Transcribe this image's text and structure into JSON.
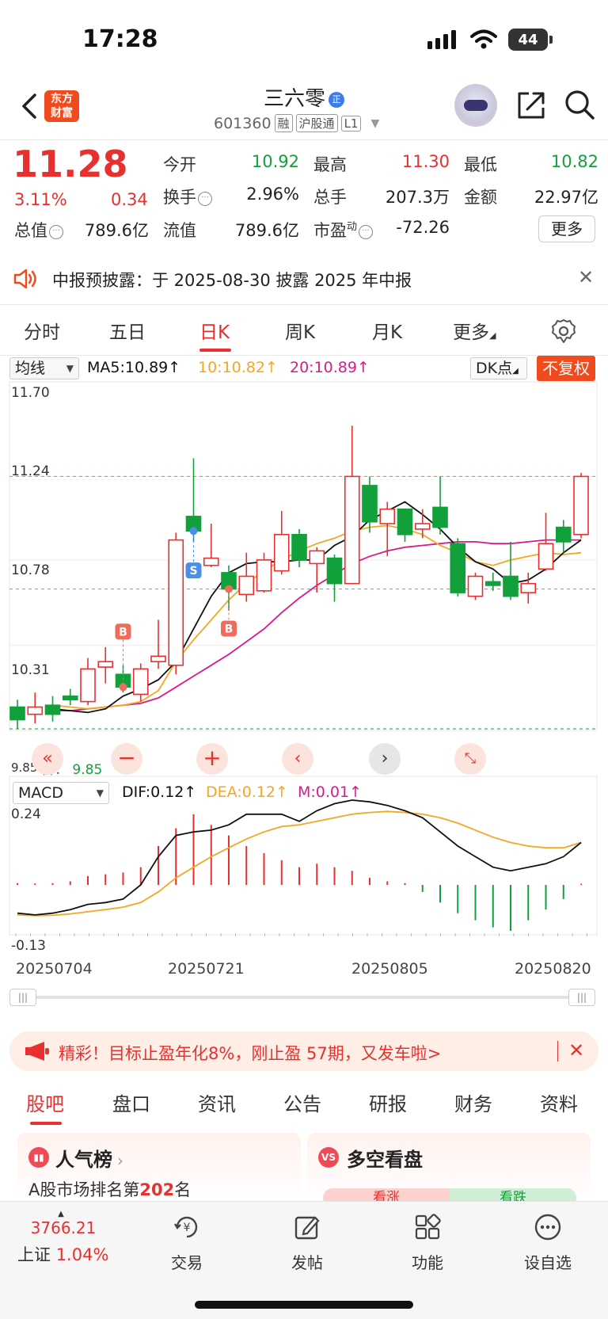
{
  "status": {
    "time": "17:28",
    "battery": "44"
  },
  "header": {
    "logo_line1": "东方",
    "logo_line2": "财富",
    "stock_name": "三六零",
    "stock_badge": "正",
    "stock_code": "601360",
    "tags": [
      "融",
      "沪股通",
      "L1"
    ]
  },
  "quote": {
    "price": "11.28",
    "change_pct": "3.11%",
    "change": "0.34",
    "fields": {
      "open_label": "今开",
      "open": "10.92",
      "high_label": "最高",
      "high": "11.30",
      "low_label": "最低",
      "low": "10.82",
      "turnover_label": "换手",
      "turnover": "2.96%",
      "volume_label": "总手",
      "volume": "207.3万",
      "amount_label": "金额",
      "amount": "22.97亿",
      "mktcap_label": "总值",
      "mktcap": "789.6亿",
      "float_label": "流值",
      "float": "789.6亿",
      "pe_label": "市盈",
      "pe_sup": "动",
      "pe": "-72.26"
    },
    "more_label": "更多"
  },
  "notice": {
    "text": "中报预披露：于 2025-08-30 披露 2025 年中报"
  },
  "chart_tabs": {
    "items": [
      "分时",
      "五日",
      "日K",
      "周K",
      "月K",
      "更多"
    ],
    "active": 2
  },
  "ma_row": {
    "select": "均线",
    "ma5": "MA5:10.89",
    "ma10": "10:10.82",
    "ma20": "20:10.89",
    "dk": "DK点",
    "fq": "不复权"
  },
  "colors": {
    "up": "#e8302f",
    "down": "#12a03a",
    "ma5": "#111111",
    "ma10": "#f5a623",
    "ma20": "#d81b8c",
    "accent": "#ef4b1f"
  },
  "price_axis": {
    "top": "11.70",
    "l2": "11.24",
    "l3": "10.78",
    "l4": "10.31",
    "low": "9.85",
    "cost_label": "价：",
    "cost_value": "9.85"
  },
  "macd_row": {
    "select": "MACD",
    "dif": "DIF:0.12",
    "dea": "DEA:0.12",
    "m": "M:0.01"
  },
  "macd_axis": {
    "top": "0.24",
    "bottom": "-0.13"
  },
  "dates": [
    "20250704",
    "20250721",
    "20250805",
    "20250820"
  ],
  "chart_data": {
    "type": "candlestick",
    "ylim": [
      9.85,
      11.7
    ],
    "x_ticks": [
      "20250704",
      "20250721",
      "20250805",
      "20250820"
    ],
    "ma_labels": [
      "MA5:10.89",
      "10:10.82",
      "20:10.89"
    ],
    "candles": [
      {
        "o": 9.97,
        "c": 9.9,
        "h": 10.01,
        "l": 9.85
      },
      {
        "o": 9.93,
        "c": 9.97,
        "h": 10.05,
        "l": 9.88
      },
      {
        "o": 9.98,
        "c": 9.93,
        "h": 10.03,
        "l": 9.89
      },
      {
        "o": 10.03,
        "c": 10.01,
        "h": 10.07,
        "l": 9.98
      },
      {
        "o": 10.0,
        "c": 10.18,
        "h": 10.24,
        "l": 9.98
      },
      {
        "o": 10.19,
        "c": 10.22,
        "h": 10.3,
        "l": 10.1
      },
      {
        "o": 10.15,
        "c": 10.08,
        "h": 10.2,
        "l": 10.05
      },
      {
        "o": 10.04,
        "c": 10.18,
        "h": 10.21,
        "l": 10.0
      },
      {
        "o": 10.22,
        "c": 10.25,
        "h": 10.45,
        "l": 10.18
      },
      {
        "o": 10.2,
        "c": 10.89,
        "h": 10.93,
        "l": 10.15
      },
      {
        "o": 11.02,
        "c": 10.94,
        "h": 11.34,
        "l": 10.88
      },
      {
        "o": 10.75,
        "c": 10.79,
        "h": 10.98,
        "l": 10.74
      },
      {
        "o": 10.71,
        "c": 10.62,
        "h": 10.75,
        "l": 10.5
      },
      {
        "o": 10.59,
        "c": 10.69,
        "h": 10.82,
        "l": 10.55
      },
      {
        "o": 10.61,
        "c": 10.78,
        "h": 10.82,
        "l": 10.6
      },
      {
        "o": 10.72,
        "c": 10.92,
        "h": 11.05,
        "l": 10.7
      },
      {
        "o": 10.92,
        "c": 10.78,
        "h": 10.95,
        "l": 10.74
      },
      {
        "o": 10.76,
        "c": 10.83,
        "h": 10.85,
        "l": 10.6
      },
      {
        "o": 10.79,
        "c": 10.65,
        "h": 10.81,
        "l": 10.55
      },
      {
        "o": 10.65,
        "c": 11.24,
        "h": 11.52,
        "l": 10.65
      },
      {
        "o": 11.19,
        "c": 10.99,
        "h": 11.24,
        "l": 10.93
      },
      {
        "o": 10.98,
        "c": 11.06,
        "h": 11.1,
        "l": 10.8
      },
      {
        "o": 11.06,
        "c": 10.92,
        "h": 11.06,
        "l": 10.88
      },
      {
        "o": 10.95,
        "c": 10.98,
        "h": 11.06,
        "l": 10.9
      },
      {
        "o": 11.07,
        "c": 10.96,
        "h": 11.24,
        "l": 10.92
      },
      {
        "o": 10.87,
        "c": 10.6,
        "h": 10.9,
        "l": 10.58
      },
      {
        "o": 10.58,
        "c": 10.69,
        "h": 10.71,
        "l": 10.56
      },
      {
        "o": 10.66,
        "c": 10.64,
        "h": 10.71,
        "l": 10.61
      },
      {
        "o": 10.69,
        "c": 10.58,
        "h": 10.88,
        "l": 10.56
      },
      {
        "o": 10.6,
        "c": 10.65,
        "h": 10.71,
        "l": 10.54
      },
      {
        "o": 10.73,
        "c": 10.87,
        "h": 11.04,
        "l": 10.72
      },
      {
        "o": 10.96,
        "c": 10.88,
        "h": 11.0,
        "l": 10.82
      },
      {
        "o": 10.92,
        "c": 11.24,
        "h": 11.26,
        "l": 10.9
      }
    ],
    "ma5": [
      9.96,
      9.95,
      9.94,
      9.96,
      10.03,
      10.07,
      10.12,
      10.22,
      10.4,
      10.58,
      10.71,
      10.76,
      10.77,
      10.77,
      10.78,
      10.78,
      10.86,
      10.91,
      11.0,
      11.05,
      11.1,
      11.03,
      10.95,
      10.85,
      10.77,
      10.73,
      10.65,
      10.67,
      10.73,
      10.82,
      10.89
    ],
    "ma10": [
      9.98,
      9.97,
      9.96,
      9.97,
      9.98,
      10.0,
      10.06,
      10.22,
      10.34,
      10.45,
      10.56,
      10.65,
      10.72,
      10.78,
      10.83,
      10.87,
      10.9,
      10.94,
      10.96,
      10.97,
      10.95,
      10.92,
      10.86,
      10.82,
      10.77,
      10.75,
      10.78,
      10.8,
      10.82,
      10.81,
      10.82
    ],
    "ma20": [
      9.95,
      9.95,
      9.96,
      9.97,
      9.98,
      9.99,
      10.02,
      10.08,
      10.14,
      10.2,
      10.26,
      10.33,
      10.4,
      10.49,
      10.57,
      10.64,
      10.7,
      10.76,
      10.8,
      10.83,
      10.85,
      10.86,
      10.87,
      10.88,
      10.88,
      10.87,
      10.87,
      10.88,
      10.89,
      10.89,
      10.89
    ],
    "macd": {
      "ylim": [
        -0.13,
        0.24
      ],
      "dif": [
        -0.08,
        -0.085,
        -0.08,
        -0.07,
        -0.055,
        -0.05,
        -0.04,
        0.0,
        0.08,
        0.14,
        0.15,
        0.155,
        0.17,
        0.2,
        0.2,
        0.2,
        0.18,
        0.21,
        0.23,
        0.24,
        0.235,
        0.225,
        0.21,
        0.19,
        0.15,
        0.11,
        0.08,
        0.05,
        0.04,
        0.05,
        0.06,
        0.08,
        0.12
      ],
      "dea": [
        -0.085,
        -0.087,
        -0.086,
        -0.082,
        -0.076,
        -0.07,
        -0.063,
        -0.05,
        -0.02,
        0.02,
        0.05,
        0.08,
        0.105,
        0.13,
        0.15,
        0.165,
        0.17,
        0.18,
        0.19,
        0.2,
        0.205,
        0.208,
        0.205,
        0.2,
        0.19,
        0.175,
        0.155,
        0.135,
        0.12,
        0.11,
        0.105,
        0.105,
        0.12
      ],
      "hist": [
        0.005,
        0.004,
        0.005,
        0.01,
        0.025,
        0.03,
        0.035,
        0.05,
        0.11,
        0.16,
        0.2,
        0.17,
        0.14,
        0.11,
        0.09,
        0.07,
        0.05,
        0.06,
        0.05,
        0.04,
        0.02,
        0.01,
        0.005,
        -0.02,
        -0.05,
        -0.08,
        -0.1,
        -0.12,
        -0.13,
        -0.1,
        -0.07,
        -0.04,
        0.003
      ]
    }
  },
  "promo": {
    "text": "精彩！目标止盈年化8%，刚止盈 57期，又发车啦>"
  },
  "info_tabs": {
    "items": [
      "股吧",
      "盘口",
      "资讯",
      "公告",
      "研报",
      "财务",
      "资料"
    ],
    "active": 0
  },
  "cards": {
    "left_title": "人气榜",
    "left_sub_pre": "A股市场排名第",
    "left_rank": "202",
    "left_sub_post": "名",
    "right_title": "多空看盘",
    "right_badge": "VS",
    "right_bull": "看涨",
    "right_bear": "看跌"
  },
  "bottom_nav": {
    "index_value": "3766.21",
    "index_name": "上证",
    "index_pct": "1.04%",
    "trade": "交易",
    "post": "发帖",
    "func": "功能",
    "watch": "设自选"
  }
}
